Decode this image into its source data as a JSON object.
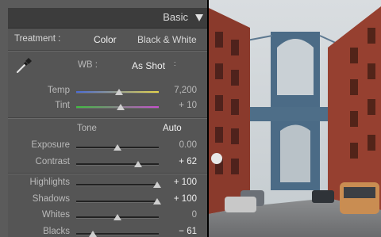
{
  "panel": {
    "title": "Basic",
    "treatment": {
      "label": "Treatment :",
      "options": [
        "Color",
        "Black & White"
      ],
      "selected": "Color"
    },
    "wb": {
      "label": "WB :",
      "value": "As Shot",
      "arrow": "∶"
    },
    "temp": {
      "label": "Temp",
      "value": "7,200",
      "fraction": 0.52
    },
    "tint": {
      "label": "Tint",
      "value": "+ 10",
      "fraction": 0.54
    },
    "tone": {
      "label": "Tone",
      "auto": "Auto"
    },
    "exposure": {
      "label": "Exposure",
      "value": "0.00",
      "fraction": 0.5
    },
    "contrast": {
      "label": "Contrast",
      "value": "+ 62",
      "fraction": 0.75
    },
    "highlights": {
      "label": "Highlights",
      "value": "+ 100",
      "fraction": 0.98
    },
    "shadows": {
      "label": "Shadows",
      "value": "+ 100",
      "fraction": 0.98
    },
    "whites": {
      "label": "Whites",
      "value": "0",
      "fraction": 0.5
    },
    "blacks": {
      "label": "Blacks",
      "value": "− 61",
      "fraction": 0.2
    }
  },
  "colors": {
    "panel_bg": "#555555",
    "header_bg": "#3c3c3c",
    "temp_gradient": [
      "#4a6bd8",
      "#e6d64a"
    ],
    "tint_gradient": [
      "#3fbf3f",
      "#c94fd0"
    ]
  },
  "icons": {
    "eyedropper": "eyedropper-icon",
    "collapse": "triangle-down-icon"
  }
}
